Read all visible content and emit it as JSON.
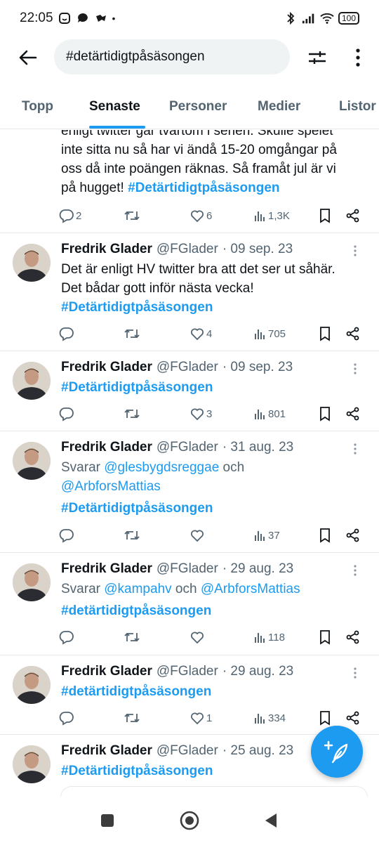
{
  "status": {
    "time": "22:05",
    "battery": "100"
  },
  "search": {
    "query": "#detärtidigtpåsäsongen"
  },
  "tabs": [
    "Topp",
    "Senaste",
    "Personer",
    "Medier",
    "Listor"
  ],
  "colors": {
    "accent": "#1d9bf0",
    "text": "#0f1419",
    "muted": "#536471"
  },
  "partial_tweet": {
    "lines": [
      "enligt twitter går tvärtom i serien. Skulle spelet",
      "inte sitta nu så har vi ändå 15-20 omgångar på",
      "oss då inte poängen räknas. Så framåt jul är vi",
      "på hugget! "
    ],
    "hashtag": "#Detärtidigtpåsäsongen",
    "stats": {
      "replies": "2",
      "likes": "6",
      "views": "1,3K"
    }
  },
  "tweets": [
    {
      "name": "Fredrik Glader",
      "handle": "@FGlader",
      "date": "· 09 sep. 23",
      "line1": "Det är enligt HV twitter bra att det ser ut såhär.",
      "line2": "Det bådar gott inför nästa vecka!",
      "hashtag": "#Detärtidigtpåsäsongen",
      "stats": {
        "replies": "",
        "likes": "4",
        "views": "705"
      }
    },
    {
      "name": "Fredrik Glader",
      "handle": "@FGlader",
      "date": "· 09 sep. 23",
      "hashtag": "#Detärtidigtpåsäsongen",
      "stats": {
        "replies": "",
        "likes": "3",
        "views": "801"
      }
    },
    {
      "name": "Fredrik Glader",
      "handle": "@FGlader",
      "date": "· 31 aug. 23",
      "reply_prefix": "Svarar ",
      "mention1": "@glesbygdsreggae",
      "reply_and": " och",
      "mention2": "@ArbforsMattias",
      "hashtag": "#Detärtidigtpåsäsongen",
      "stats": {
        "replies": "",
        "likes": "",
        "views": "37"
      }
    },
    {
      "name": "Fredrik Glader",
      "handle": "@FGlader",
      "date": "· 29 aug. 23",
      "reply_prefix": "Svarar ",
      "mention1": "@kampahv",
      "reply_and": " och ",
      "mention2": "@ArbforsMattias",
      "hashtag": "#detärtidigtpåsäsongen",
      "stats": {
        "replies": "",
        "likes": "",
        "views": "118"
      }
    },
    {
      "name": "Fredrik Glader",
      "handle": "@FGlader",
      "date": "· 29 aug. 23",
      "hashtag": "#detärtidigtpåsäsongen",
      "stats": {
        "replies": "",
        "likes": "1",
        "views": "334"
      }
    },
    {
      "name": "Fredrik Glader",
      "handle": "@FGlader",
      "date": "· 25 aug. 23",
      "hashtag": "#Detärtidigtpåsäsongen"
    }
  ]
}
